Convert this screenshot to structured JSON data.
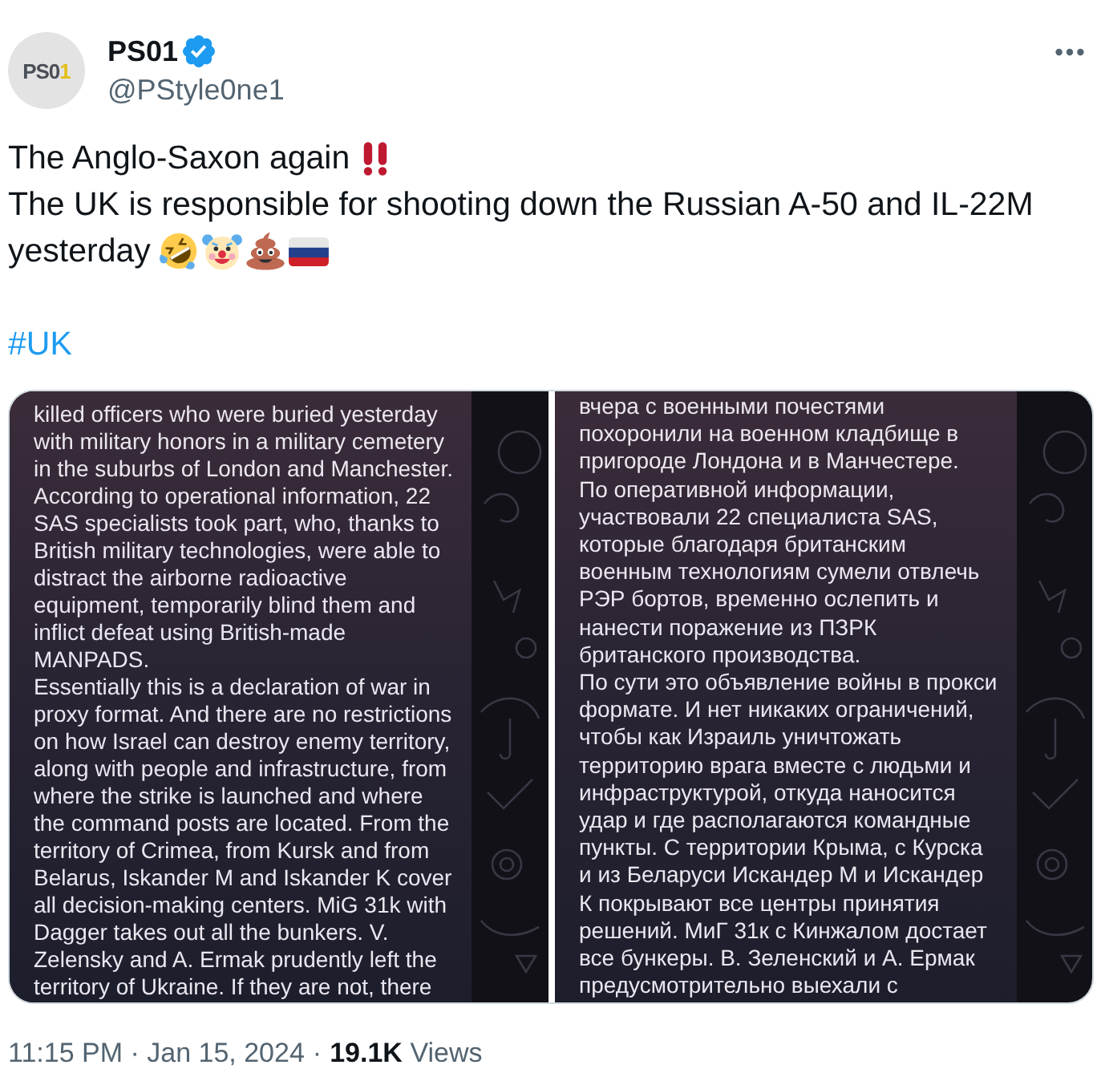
{
  "author": {
    "avatar": {
      "logo_text": "PS0",
      "logo_accent": "1"
    },
    "name": "PS01",
    "verified": true,
    "handle": "@PStyle0ne1"
  },
  "tweet": {
    "lines": [
      {
        "text": "The Anglo-Saxon again",
        "emoji": [
          {
            "kind": "double_exclamation"
          }
        ]
      },
      {
        "text": "The UK is responsible for shooting down the Russian A-50 and IL-22M"
      },
      {
        "text": "yesterday",
        "emoji": [
          {
            "kind": "rofl"
          },
          {
            "kind": "clown"
          },
          {
            "kind": "poop"
          },
          {
            "kind": "flag_russia"
          }
        ]
      }
    ],
    "hashtag": "#UK"
  },
  "media": [
    {
      "paragraphs": [
        [
          "killed officers who were buried yesterday",
          "with military honors in a military cemetery",
          "in the suburbs of London and Manchester.",
          "According to operational information, 22",
          "SAS specialists took part, who, thanks to",
          "British military technologies, were able to",
          "distract the airborne radioactive",
          "equipment, temporarily blind them and",
          "inflict defeat using British-made",
          "MANPADS."
        ],
        [
          "Essentially this is a declaration of war in",
          "proxy format. And there are no restrictions",
          "on how Israel can destroy enemy territory,",
          "along with people and infrastructure, from",
          "where the strike is launched and where",
          "the command posts are located. From the",
          "territory of Crimea, from Kursk and from",
          "Belarus, Iskander M and Iskander K cover",
          "all decision-making centers. MiG 31k with",
          "Dagger takes out all the bunkers. V.",
          "Zelensky and A. Ermak prudently left the",
          "territory of Ukraine. If they are not, there"
        ]
      ]
    },
    {
      "paragraphs": [
        [
          "вчера с военными почестями",
          "похоронили на военном кладбище в",
          "пригороде Лондона и в Манчестере.",
          "По оперативной информации,",
          "участвовали 22 специалиста SAS,",
          "которые благодаря британским",
          "военным технологиям сумели отвлечь",
          "РЭР бортов, временно ослепить и",
          "нанести поражение из ПЗРК",
          "британского производства."
        ],
        [
          "По сути это объявление войны в прокси",
          "формате. И нет никаких ограничений,",
          "чтобы как Израиль уничтожать",
          "территорию врага вместе с людьми и",
          "инфраструктурой, откуда наносится",
          "удар и где располагаются командные",
          "пункты. С территории Крыма, с Курска",
          "и из Беларуси Искандер М и Искандер",
          "К покрывают все центры принятия",
          "решений. МиГ 31к с Кинжалом достает",
          "все бункеры. В. Зеленский и А. Ермак",
          "предусмотрительно выехали с"
        ]
      ]
    }
  ],
  "footer": {
    "time": "11:15 PM · Jan 15, 2024",
    "separator": "·",
    "views": "**19.1K** Views"
  }
}
